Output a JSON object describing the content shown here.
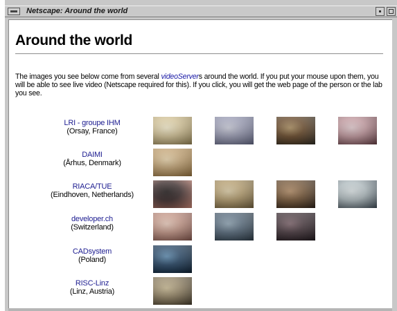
{
  "window": {
    "title": "Netscape: Around the world"
  },
  "page": {
    "heading": "Around the world",
    "intro_before": "The images you see below come from several ",
    "intro_link": "videoServer",
    "intro_after": "s around the world. If you put your mouse upon them, you will be able to see live video (Netscape required for this). If you click, you will get the web page of the person or the lab you see."
  },
  "sites": [
    {
      "name": "LRI - groupe IHM",
      "location": "(Orsay, France)",
      "thumbnails": [
        {
          "icon": "webcam-person-icon",
          "colors": [
            "#d8c79a",
            "#8a7a4e",
            "#f2e9c8"
          ]
        },
        {
          "icon": "webcam-room-icon",
          "colors": [
            "#9ea0b8",
            "#5c607a",
            "#c8cad8"
          ]
        },
        {
          "icon": "webcam-office-icon",
          "colors": [
            "#6a4a2a",
            "#2c2a24",
            "#a88a5a"
          ]
        },
        {
          "icon": "webcam-office-icon",
          "colors": [
            "#c49aa0",
            "#5e3a40",
            "#e0c8cc"
          ]
        }
      ]
    },
    {
      "name": "DAIMI",
      "location": "(Århus, Denmark)",
      "thumbnails": [
        {
          "icon": "webcam-room-icon",
          "colors": [
            "#c8a878",
            "#8a6a3a",
            "#e6d0a6"
          ]
        }
      ]
    },
    {
      "name": "RIACA/TUE",
      "location": "(Eindhoven, Netherlands)",
      "thumbnails": [
        {
          "icon": "webcam-person-icon",
          "colors": [
            "#3a2a2a",
            "#c08070",
            "#1a1414"
          ]
        },
        {
          "icon": "webcam-office-icon",
          "colors": [
            "#b8a070",
            "#6a5a3a",
            "#d8c8a0"
          ]
        },
        {
          "icon": "webcam-office-icon",
          "colors": [
            "#7a5a3a",
            "#2a2018",
            "#b08860"
          ]
        },
        {
          "icon": "webcam-office-icon",
          "colors": [
            "#b4c0c4",
            "#3a4650",
            "#d8e0e2"
          ]
        }
      ]
    },
    {
      "name": "developer.ch",
      "location": "(Switzerland)",
      "thumbnails": [
        {
          "icon": "webcam-person-icon",
          "colors": [
            "#c89a8a",
            "#7a5048",
            "#e8c8b8"
          ]
        },
        {
          "icon": "webcam-office-icon",
          "colors": [
            "#5a6e80",
            "#2a3640",
            "#8aa0b0"
          ]
        },
        {
          "icon": "webcam-office-icon",
          "colors": [
            "#4a3a40",
            "#1e181c",
            "#7a6068"
          ]
        }
      ]
    },
    {
      "name": "CADsystem",
      "location": "(Poland)",
      "thumbnails": [
        {
          "icon": "webcam-office-icon",
          "colors": [
            "#2a4a6a",
            "#0e1e2e",
            "#5a8ab0"
          ]
        }
      ]
    },
    {
      "name": "RISC-Linz",
      "location": "(Linz, Austria)",
      "thumbnails": [
        {
          "icon": "webcam-room-icon",
          "colors": [
            "#9a8a6a",
            "#3e3628",
            "#c8b890"
          ]
        }
      ]
    }
  ]
}
